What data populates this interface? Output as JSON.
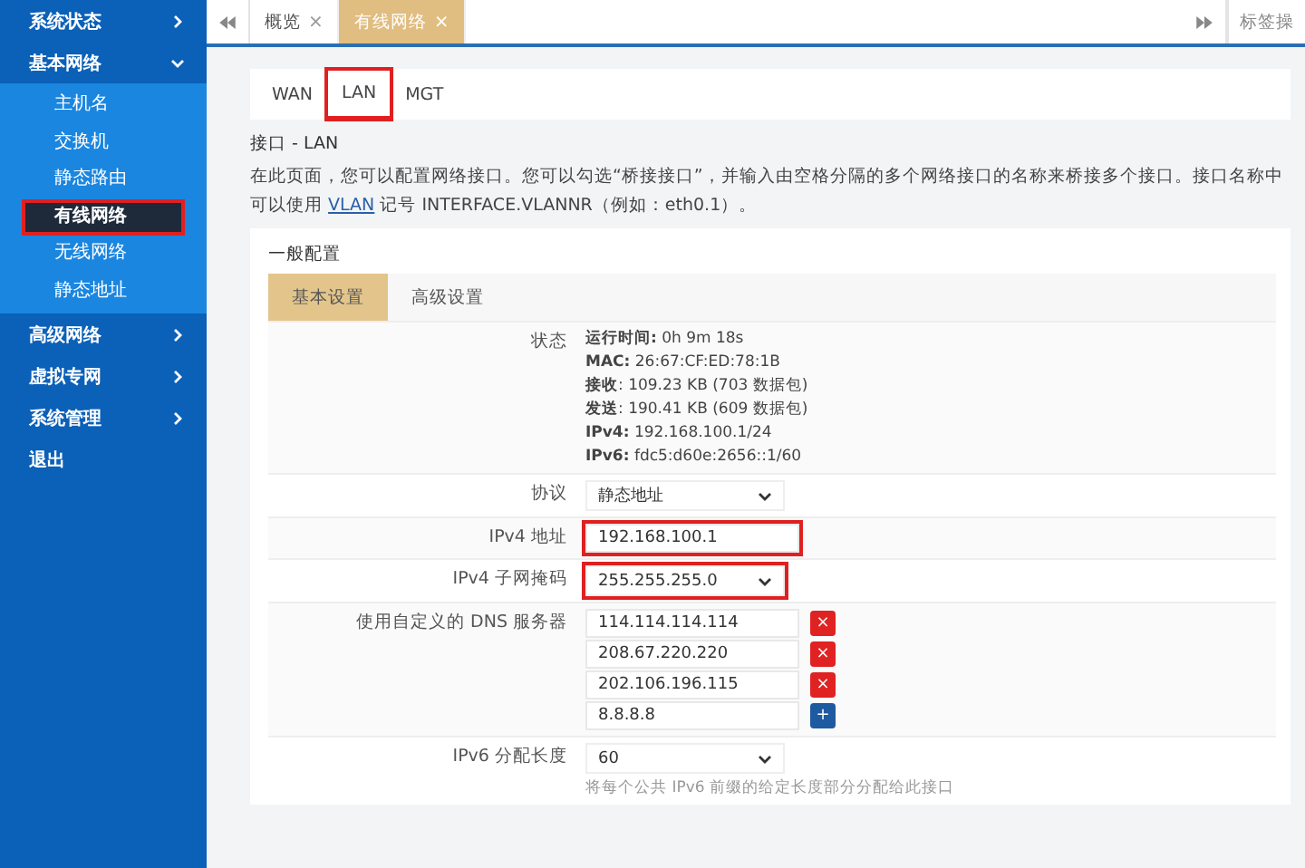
{
  "sidebar": {
    "items": [
      {
        "label": "系统状态",
        "kind": "group",
        "expanded": false
      },
      {
        "label": "基本网络",
        "kind": "group",
        "expanded": true,
        "children": [
          {
            "label": "主机名",
            "selected": false,
            "annotated": false
          },
          {
            "label": "交换机",
            "selected": false,
            "annotated": false
          },
          {
            "label": "静态路由",
            "selected": false,
            "annotated": false
          },
          {
            "label": "有线网络",
            "selected": true,
            "annotated": true
          },
          {
            "label": "无线网络",
            "selected": false,
            "annotated": false
          },
          {
            "label": "静态地址",
            "selected": false,
            "annotated": false
          }
        ]
      },
      {
        "label": "高级网络",
        "kind": "group",
        "expanded": false
      },
      {
        "label": "虚拟专网",
        "kind": "group",
        "expanded": false
      },
      {
        "label": "系统管理",
        "kind": "group",
        "expanded": false
      },
      {
        "label": "退出",
        "kind": "link"
      }
    ]
  },
  "tab_bar": {
    "tabs": [
      {
        "label": "概览",
        "close": "×",
        "selected": false
      },
      {
        "label": "有线网络",
        "close": "×",
        "selected": true
      }
    ],
    "menu_label": "标签操"
  },
  "interface_tabs": [
    {
      "label": "WAN",
      "selected": false,
      "annotated": false
    },
    {
      "label": "LAN",
      "selected": true,
      "annotated": true
    },
    {
      "label": "MGT",
      "selected": false,
      "annotated": false
    }
  ],
  "heading": "接口 - LAN",
  "description": {
    "before": "在此页面，您可以配置网络接口。您可以勾选“桥接接口”，并输入由空格分隔的多个网络接口的名称来桥接多个接口。接口名称中可以使用 ",
    "link": "VLAN",
    "after": " 记号 INTERFACE.VLANNR（例如：eth0.1）。"
  },
  "section": {
    "title": "一般配置",
    "tabs": [
      {
        "label": "基本设置",
        "selected": true
      },
      {
        "label": "高级设置",
        "selected": false
      }
    ],
    "status": {
      "label": "状态",
      "lines": [
        "**运行时间:** 0h 9m 18s",
        "**MAC:** 26:67:CF:ED:78:1B",
        "**接收**: 109.23 KB (703 数据包)",
        "**发送**: 190.41 KB (609 数据包)",
        "**IPv4:** 192.168.100.1/24",
        "**IPv6:** fdc5:d60e:2656::1/60"
      ]
    },
    "fields": [
      {
        "label": "协议",
        "kind": "select",
        "value": "静态地址",
        "annotated": false
      },
      {
        "label": "IPv4 地址",
        "kind": "input",
        "value": "192.168.100.1",
        "annotated": true
      },
      {
        "label": "IPv4 子网掩码",
        "kind": "select",
        "value": "255.255.255.0",
        "annotated": true
      },
      {
        "label": "使用自定义的 DNS 服务器",
        "kind": "list",
        "entries": [
          {
            "value": "114.114.114.114",
            "kind": "remove",
            "symbol": "×"
          },
          {
            "value": "208.67.220.220",
            "kind": "remove",
            "symbol": "×"
          },
          {
            "value": "202.106.196.115",
            "kind": "remove",
            "symbol": "×"
          },
          {
            "value": "8.8.8.8",
            "kind": "add",
            "symbol": "+"
          }
        ]
      },
      {
        "label": "IPv6 分配长度",
        "kind": "select",
        "value": "60",
        "hint": "将每个公共 IPv6 前缀的给定长度部分分配给此接口",
        "annotated": false
      }
    ]
  }
}
